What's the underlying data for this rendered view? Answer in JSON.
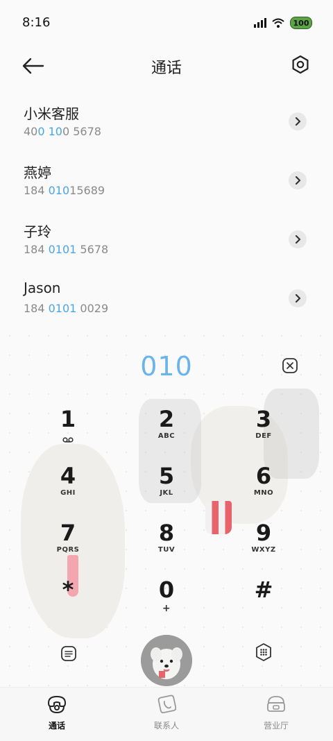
{
  "status_bar": {
    "time": "8:16",
    "battery": "100",
    "battery_color": "#5ba547"
  },
  "header": {
    "title": "通话"
  },
  "contacts": [
    {
      "name": "小米客服",
      "number_parts": [
        "40",
        "0 10",
        "0 5678"
      ]
    },
    {
      "name": "燕婷",
      "number_parts": [
        "184 ",
        "010",
        "15689"
      ]
    },
    {
      "name": "子玲",
      "number_parts": [
        "184 ",
        "0101",
        " 5678"
      ]
    },
    {
      "name": "Jason",
      "number_parts": [
        "184 ",
        "0101",
        " 0029"
      ]
    }
  ],
  "dial": {
    "input": "010",
    "input_color": "#6ab4ec"
  },
  "keypad": [
    {
      "digit": "1",
      "letters": ""
    },
    {
      "digit": "2",
      "letters": "ABC"
    },
    {
      "digit": "3",
      "letters": "DEF"
    },
    {
      "digit": "4",
      "letters": "GHI"
    },
    {
      "digit": "5",
      "letters": "JKL"
    },
    {
      "digit": "6",
      "letters": "MNO"
    },
    {
      "digit": "7",
      "letters": "PQRS"
    },
    {
      "digit": "8",
      "letters": "TUV"
    },
    {
      "digit": "9",
      "letters": "WXYZ"
    },
    {
      "digit": "*",
      "letters": ""
    },
    {
      "digit": "0",
      "letters": "+"
    },
    {
      "digit": "#",
      "letters": ""
    }
  ],
  "tabs": [
    {
      "label": "通话",
      "icon": "phone-icon",
      "active": true
    },
    {
      "label": "联系人",
      "icon": "contacts-icon",
      "active": false
    },
    {
      "label": "营业厅",
      "icon": "store-icon",
      "active": false
    }
  ]
}
